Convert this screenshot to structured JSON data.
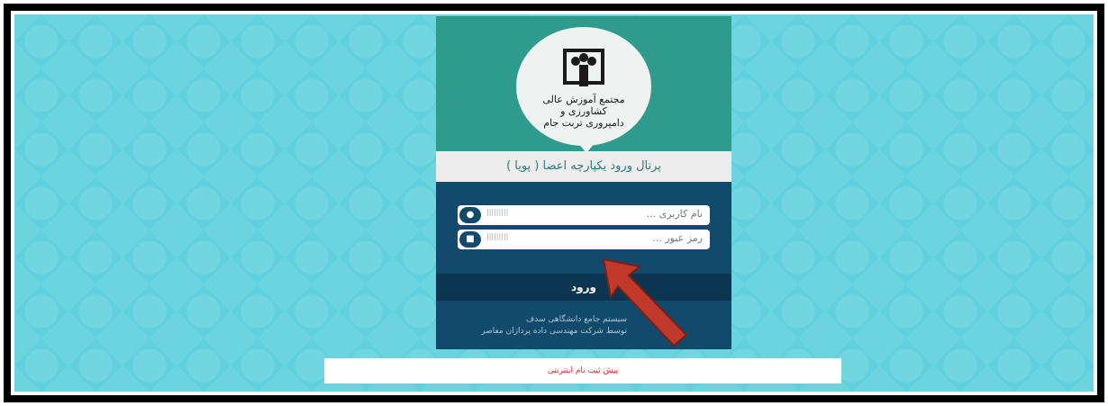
{
  "header": {
    "logo_line1": "مجتمع آموزش عالی کشاورزی و",
    "logo_line2": "دامپروری تربت جام"
  },
  "portal_title": "پرتال ورود یکپارچه اعضا ( پویا )",
  "form": {
    "username_placeholder": "نام کاربری ...",
    "password_placeholder": "رمز عبور ...",
    "field_code": "|||||||||",
    "login_label": "ورود"
  },
  "footer": {
    "line1": "سیستم جامع دانشگاهی سدف",
    "line2": "توسط شرکت مهندسی داده پردازان معاصر"
  },
  "pre_registration_label": "پیش ثبت نام اینترنتی",
  "colors": {
    "background": "#5fd0dc",
    "header": "#2f9b8c",
    "form": "#124a6b",
    "login_button": "#0b3550",
    "arrow": "#c0392b",
    "pre_registration_text": "#e02020"
  },
  "icons": {
    "user": "user-icon",
    "lock": "lock-icon",
    "arrow": "red-arrow-icon"
  }
}
